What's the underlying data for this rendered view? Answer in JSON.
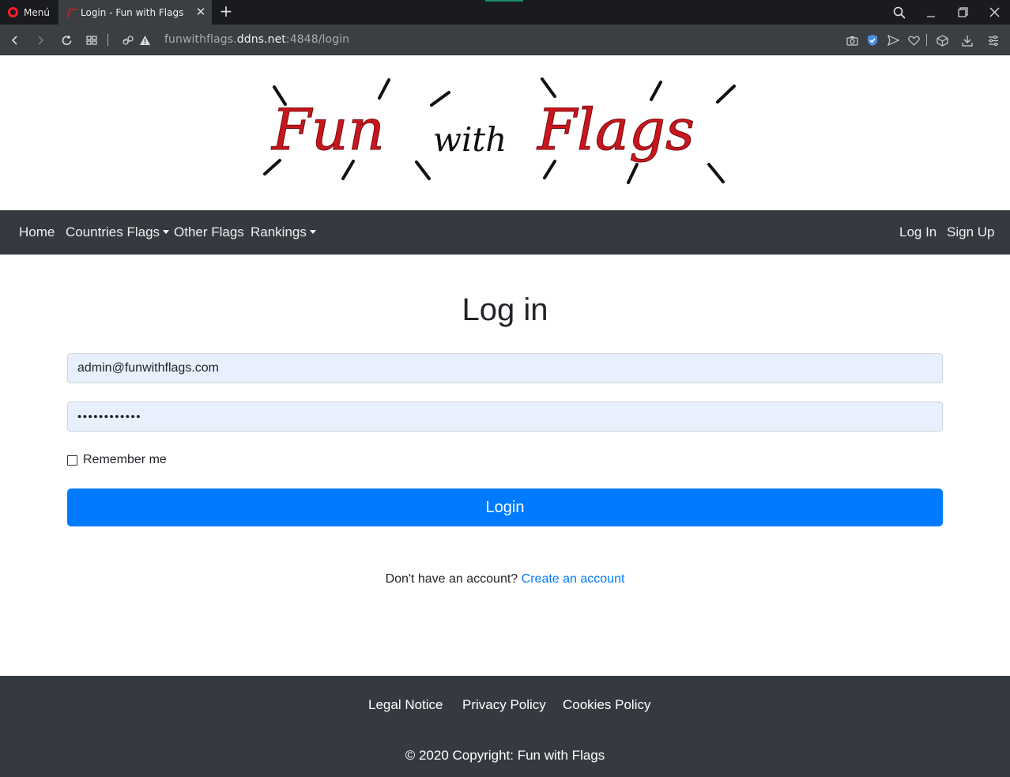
{
  "browser": {
    "menu_label": "Menú",
    "tab_title": "Login - Fun with Flags",
    "url_prefix": "funwithflags.",
    "url_domain": "ddns.net",
    "url_suffix": ":4848/login"
  },
  "logo": {
    "word1": "Fun",
    "word2": "with",
    "word3": "Flags",
    "color": "#c8161d"
  },
  "navbar": {
    "items": [
      {
        "label": "Home"
      },
      {
        "label": "Countries Flags"
      },
      {
        "label": "Other Flags"
      },
      {
        "label": "Rankings"
      }
    ],
    "login": "Log In",
    "signup": "Sign Up"
  },
  "form": {
    "title": "Log in",
    "email_value": "admin@funwithflags.com",
    "password_value": "••••••••••••",
    "remember_label": "Remember me",
    "submit_label": "Login",
    "signup_prompt": "Don't have an account?",
    "signup_link": "Create an account"
  },
  "footer": {
    "links": [
      {
        "label": "Legal Notice"
      },
      {
        "label": "Privacy Policy"
      },
      {
        "label": "Cookies Policy"
      }
    ],
    "copyright": "© 2020 Copyright: Fun with Flags"
  },
  "colors": {
    "accent": "#007bff",
    "navbar": "#343a40",
    "input_bg": "#e8f0fe"
  }
}
